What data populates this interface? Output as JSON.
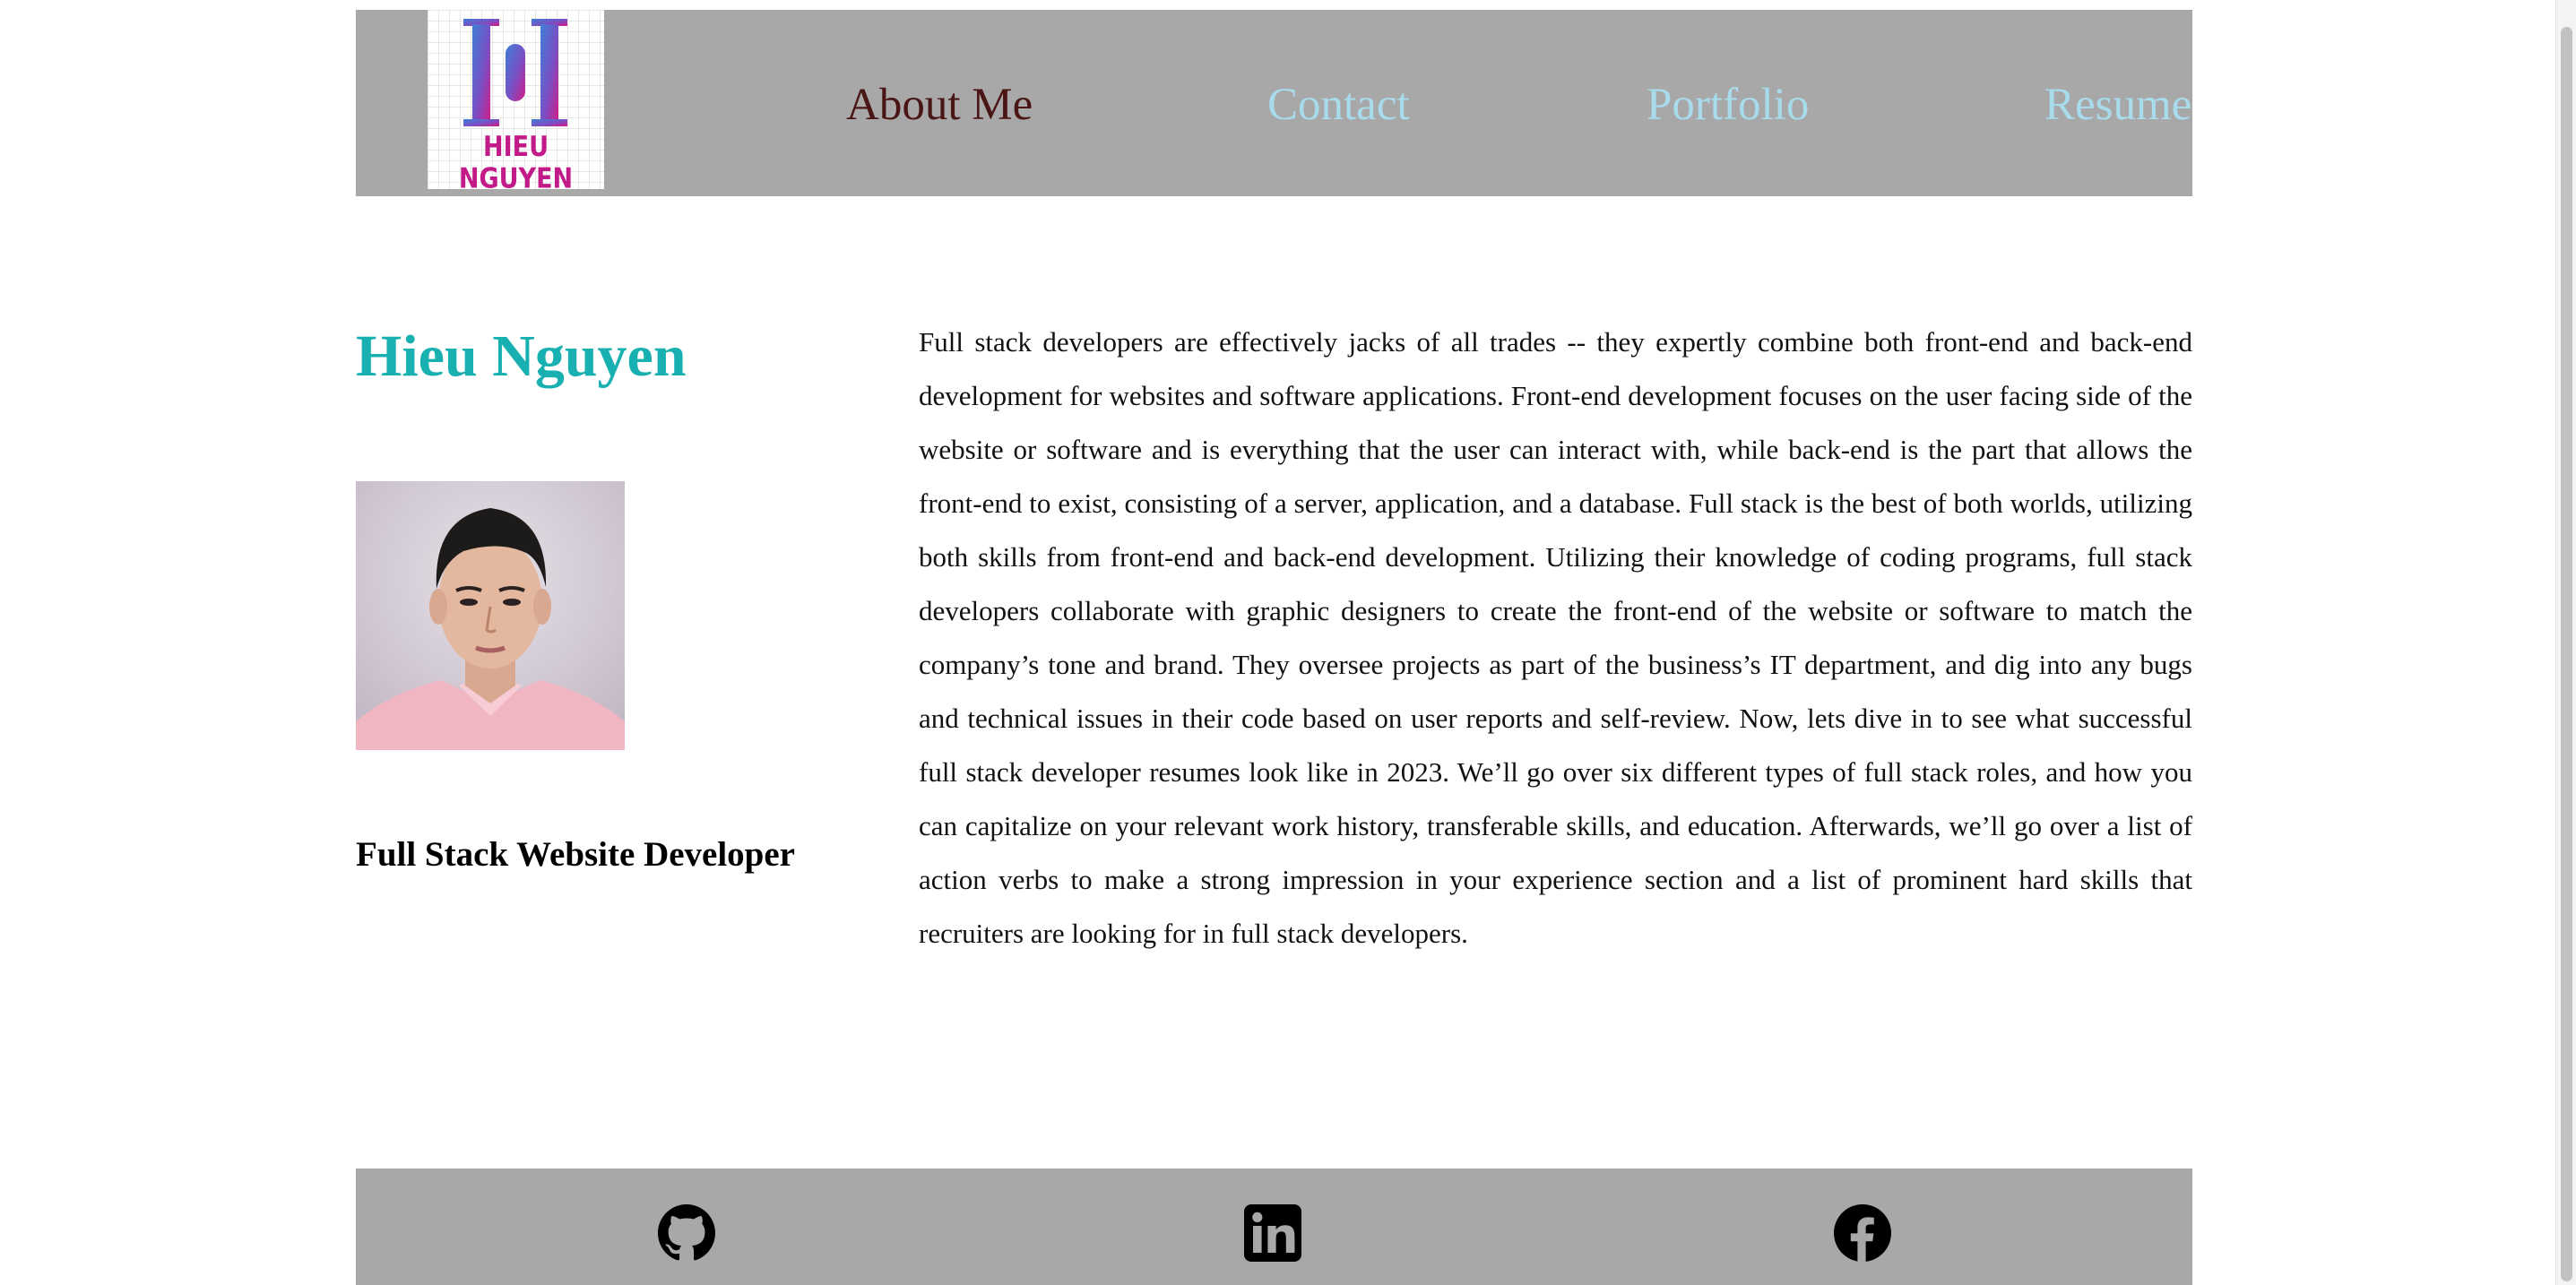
{
  "header": {
    "logo_text": "HIEU NGUYEN",
    "nav": [
      {
        "label": "About Me",
        "color": "#4a1515"
      },
      {
        "label": "Contact",
        "color": "#a8dbec"
      },
      {
        "label": "Portfolio",
        "color": "#a8dbec"
      },
      {
        "label": "Resume",
        "color": "#a8dbec"
      }
    ]
  },
  "main": {
    "name": "Hieu Nguyen",
    "role": "Full Stack Website Developer",
    "bio": "Full stack developers are effectively jacks of all trades -- they expertly combine both front-end and back-end development for websites and software applications. Front-end development focuses on the user facing side of the website or software and is everything that the user can interact with, while back-end is the part that allows the front-end to exist, consisting of a server, application, and a database. Full stack is the best of both worlds, utilizing both skills from front-end and back-end development. Utilizing their knowledge of coding programs, full stack developers collaborate with graphic designers to create the front-end of the website or software to match the company’s tone and brand. They oversee projects as part of the business’s IT department, and dig into any bugs and technical issues in their code based on user reports and self-review. Now, lets dive in to see what successful full stack developer resumes look like in 2023. We’ll go over six different types of full stack roles, and how you can capitalize on your relevant work history, transferable skills, and education. Afterwards, we’ll go over a list of action verbs to make a strong impression in your experience section and a list of prominent hard skills that recruiters are looking for in full stack developers."
  },
  "footer": {
    "social": [
      {
        "icon": "github-icon"
      },
      {
        "icon": "linkedin-icon"
      },
      {
        "icon": "facebook-icon"
      }
    ]
  },
  "colors": {
    "header_bg": "#a8a8a8",
    "footer_bg": "#a8a8a8",
    "name": "#18b0b0",
    "active_nav": "#4a1515",
    "nav": "#a8dbec",
    "logo_pink": "#c21a88",
    "logo_blue": "#3e7fd6"
  }
}
